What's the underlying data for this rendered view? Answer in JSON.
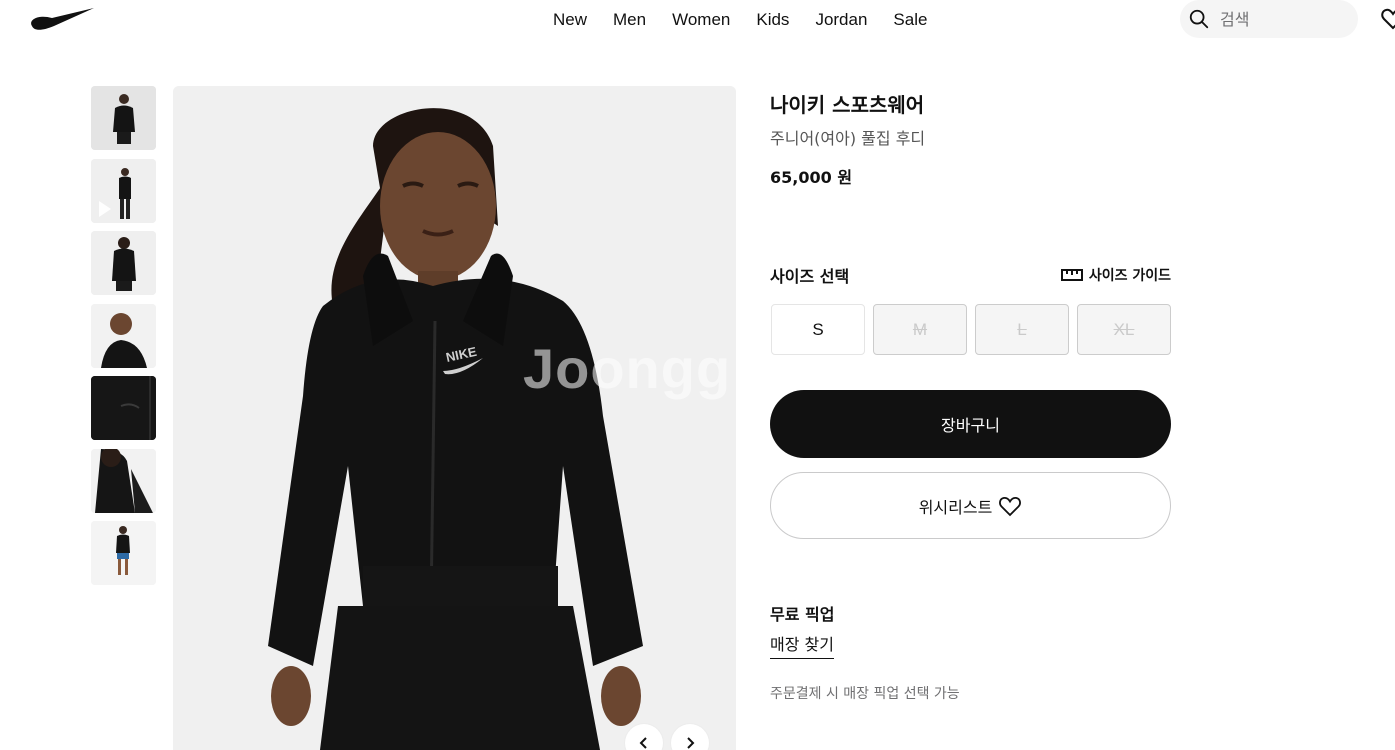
{
  "header": {
    "nav": [
      "New",
      "Men",
      "Women",
      "Kids",
      "Jordan",
      "Sale"
    ],
    "search_placeholder": "검색"
  },
  "gallery": {
    "thumbnail_count": 7,
    "watermark": "Joongg"
  },
  "product": {
    "title": "나이키 스포츠웨어",
    "subtitle": "주니어(여아) 풀집 후디",
    "price": "65,000 원"
  },
  "size": {
    "title": "사이즈 선택",
    "guide_label": "사이즈 가이드",
    "options": [
      {
        "label": "S",
        "available": true
      },
      {
        "label": "M",
        "available": false
      },
      {
        "label": "L",
        "available": false
      },
      {
        "label": "XL",
        "available": false
      }
    ]
  },
  "actions": {
    "cart_label": "장바구니",
    "wishlist_label": "위시리스트"
  },
  "pickup": {
    "title": "무료 픽업",
    "store_link": "매장 찾기",
    "note": "주문결제 시 매장 픽업 선택 가능"
  },
  "colors": {
    "primary": "#111111",
    "background": "#ffffff",
    "muted_text": "#707072",
    "image_bg": "#f1f1f1"
  }
}
